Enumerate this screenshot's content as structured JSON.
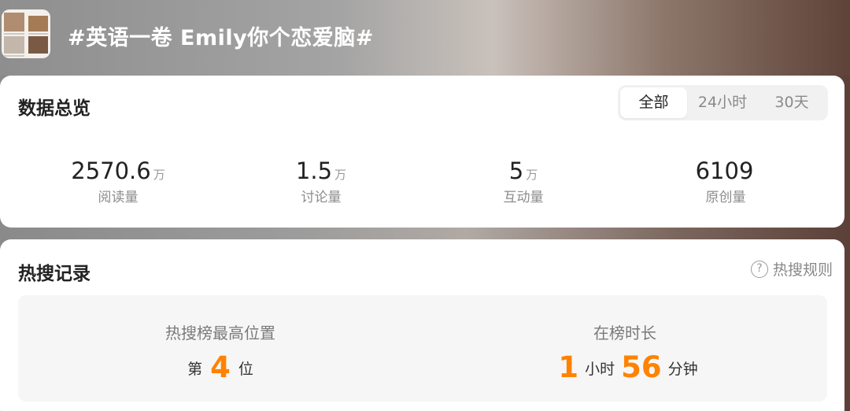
{
  "header": {
    "topic_title": "#英语一卷 Emily你个恋爱脑#",
    "thumbnail_icon": "topic-thumbnail"
  },
  "overview": {
    "title": "数据总览",
    "tabs": [
      {
        "label": "全部",
        "active": true
      },
      {
        "label": "24小时",
        "active": false
      },
      {
        "label": "30天",
        "active": false
      }
    ],
    "stats": [
      {
        "value": "2570.6",
        "unit": "万",
        "label": "阅读量"
      },
      {
        "value": "1.5",
        "unit": "万",
        "label": "讨论量"
      },
      {
        "value": "5",
        "unit": "万",
        "label": "互动量"
      },
      {
        "value": "6109",
        "unit": "",
        "label": "原创量"
      }
    ]
  },
  "hot_search": {
    "title": "热搜记录",
    "rules_label": "热搜规则",
    "rules_icon": "question-circle-icon",
    "highest_rank": {
      "label": "热搜榜最高位置",
      "prefix": "第",
      "value": "4",
      "suffix": "位"
    },
    "duration": {
      "label": "在榜时长",
      "hours": "1",
      "hours_unit": "小时",
      "minutes": "56",
      "minutes_unit": "分钟"
    }
  },
  "colors": {
    "accent": "#ff8200",
    "card_bg": "#ffffff",
    "panel_bg": "#f6f6f6"
  }
}
